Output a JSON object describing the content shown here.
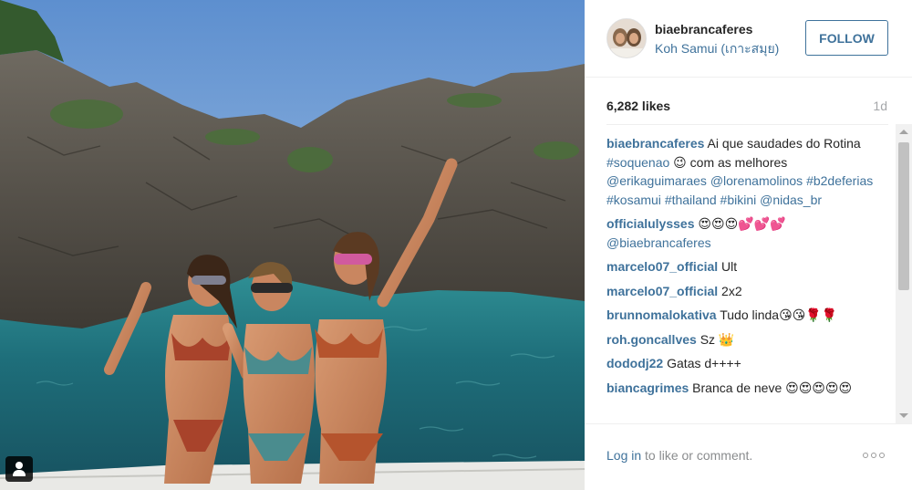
{
  "post": {
    "username": "biaebrancaferes",
    "location": "Koh Samui (เกาะสมุย)",
    "follow_label": "FOLLOW",
    "likes": "6,282 likes",
    "timestamp": "1d"
  },
  "caption": {
    "user": "biaebrancaferes",
    "parts": [
      {
        "t": "text",
        "v": " Ai que saudades do Rotina "
      },
      {
        "t": "tag",
        "v": "#soquenao"
      },
      {
        "t": "text",
        "v": " 😉 com as melhores "
      },
      {
        "t": "tag",
        "v": "@erikaguimaraes"
      },
      {
        "t": "text",
        "v": " "
      },
      {
        "t": "tag",
        "v": "@lorenamolinos"
      },
      {
        "t": "text",
        "v": " "
      },
      {
        "t": "tag",
        "v": "#b2deferias"
      },
      {
        "t": "text",
        "v": " "
      },
      {
        "t": "tag",
        "v": "#kosamui"
      },
      {
        "t": "text",
        "v": " "
      },
      {
        "t": "tag",
        "v": "#thailand"
      },
      {
        "t": "text",
        "v": " "
      },
      {
        "t": "tag",
        "v": "#bikini"
      },
      {
        "t": "text",
        "v": " "
      },
      {
        "t": "tag",
        "v": "@nidas_br"
      }
    ]
  },
  "comments": [
    {
      "user": "officialulysses",
      "parts": [
        {
          "t": "text",
          "v": " 😍😍😍💕💕💕 "
        },
        {
          "t": "tag",
          "v": "@biaebrancaferes"
        }
      ]
    },
    {
      "user": "marcelo07_official",
      "parts": [
        {
          "t": "text",
          "v": " Ult"
        }
      ]
    },
    {
      "user": "marcelo07_official",
      "parts": [
        {
          "t": "text",
          "v": " 2x2"
        }
      ]
    },
    {
      "user": "brunnomalokativa",
      "parts": [
        {
          "t": "text",
          "v": " Tudo linda😘😘🌹🌹"
        }
      ]
    },
    {
      "user": "roh.goncallves",
      "parts": [
        {
          "t": "text",
          "v": " Sz 👑"
        }
      ]
    },
    {
      "user": "dododj22",
      "parts": [
        {
          "t": "text",
          "v": " Gatas d++++"
        }
      ]
    },
    {
      "user": "biancagrimes",
      "parts": [
        {
          "t": "text",
          "v": " Branca de neve 😍😍😍😍😍"
        }
      ]
    }
  ],
  "footer": {
    "login_link": "Log in",
    "login_rest": " to like or comment."
  },
  "icons": {
    "user_tag": "person-icon",
    "more": "ellipsis-icon"
  },
  "colors": {
    "link": "#3f729b",
    "muted": "#a5a7aa",
    "text": "#262626"
  }
}
